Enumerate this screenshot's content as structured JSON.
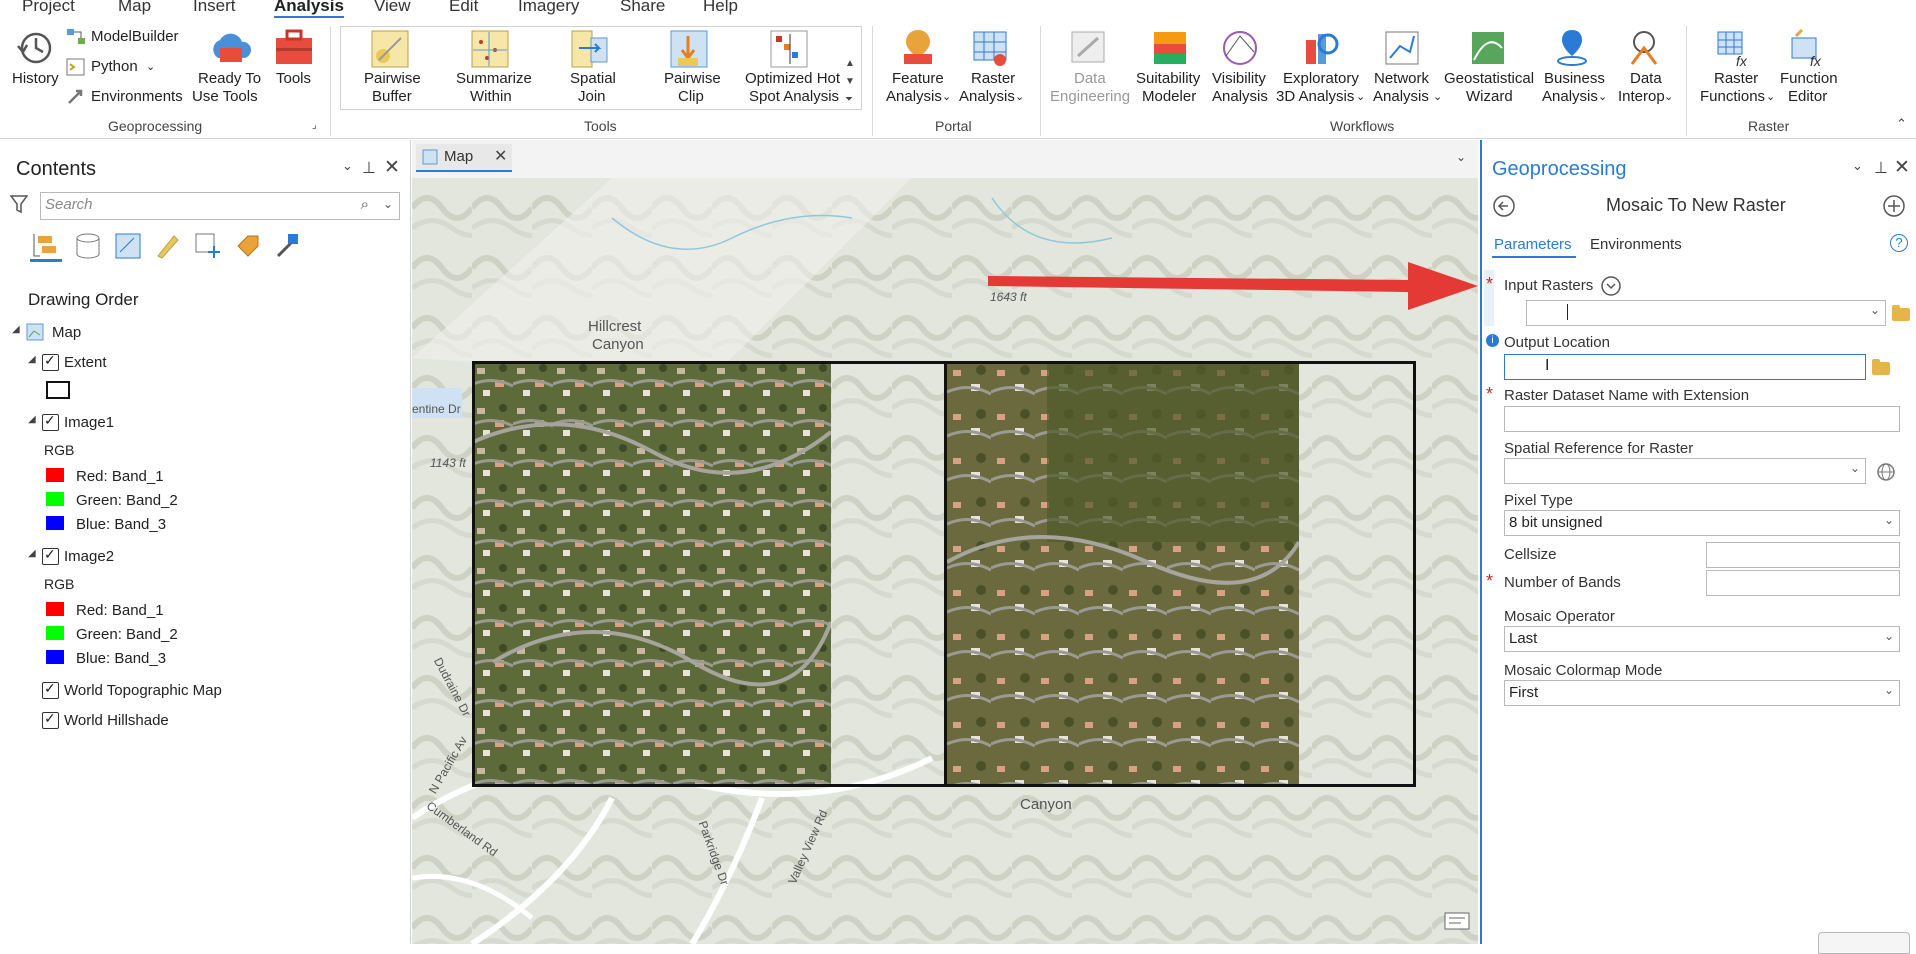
{
  "menu": {
    "tabs": [
      {
        "label": "Project",
        "active": false
      },
      {
        "label": "Map",
        "active": false
      },
      {
        "label": "Insert",
        "active": false
      },
      {
        "label": "Analysis",
        "active": true
      },
      {
        "label": "View",
        "active": false
      },
      {
        "label": "Edit",
        "active": false
      },
      {
        "label": "Imagery",
        "active": false
      },
      {
        "label": "Share",
        "active": false
      },
      {
        "label": "Help",
        "active": false
      }
    ]
  },
  "ribbon": {
    "geoprocessing": {
      "history": "History",
      "modelbuilder": "ModelBuilder",
      "python": "Python",
      "environments": "Environments",
      "ready_to_use_1": "Ready To",
      "ready_to_use_2": "Use Tools",
      "tools": "Tools",
      "group_label": "Geoprocessing"
    },
    "tools": {
      "items": [
        {
          "l1": "Pairwise",
          "l2": "Buffer"
        },
        {
          "l1": "Summarize",
          "l2": "Within"
        },
        {
          "l1": "Spatial",
          "l2": "Join"
        },
        {
          "l1": "Pairwise",
          "l2": "Clip"
        },
        {
          "l1": "Optimized Hot",
          "l2": "Spot Analysis"
        }
      ],
      "group_label": "Tools"
    },
    "portal": {
      "feature_1": "Feature",
      "feature_2": "Analysis",
      "raster_1": "Raster",
      "raster_2": "Analysis",
      "group_label": "Portal"
    },
    "workflows": {
      "items": [
        {
          "l1": "Data",
          "l2": "Engineering",
          "disabled": true
        },
        {
          "l1": "Suitability",
          "l2": "Modeler",
          "disabled": false
        },
        {
          "l1": "Visibility",
          "l2": "Analysis",
          "disabled": false
        },
        {
          "l1": "Exploratory",
          "l2": "3D Analysis",
          "disabled": false
        },
        {
          "l1": "Network",
          "l2": "Analysis",
          "disabled": false
        },
        {
          "l1": "Geostatistical",
          "l2": "Wizard",
          "disabled": false
        },
        {
          "l1": "Business",
          "l2": "Analysis",
          "disabled": false
        },
        {
          "l1": "Data",
          "l2": "Interop",
          "disabled": false
        }
      ],
      "group_label": "Workflows"
    },
    "raster": {
      "functions_1": "Raster",
      "functions_2": "Functions",
      "editor_1": "Function",
      "editor_2": "Editor",
      "group_label": "Raster"
    }
  },
  "contents": {
    "title": "Contents",
    "search_placeholder": "Search",
    "drawing_order": "Drawing Order",
    "map": "Map",
    "extent": "Extent",
    "image1": "Image1",
    "image2": "Image2",
    "rgb": "RGB",
    "bands": [
      {
        "label": "Red:   Band_1",
        "color": "#ff0000"
      },
      {
        "label": "Green: Band_2",
        "color": "#00ff00"
      },
      {
        "label": "Blue:  Band_3",
        "color": "#0000ff"
      }
    ],
    "topo": "World Topographic Map",
    "hillshade": "World Hillshade"
  },
  "map": {
    "tab_label": "Map",
    "labels": {
      "hillcrest": "Hillcrest",
      "canyon1": "Canyon",
      "canyon2": "Canyon",
      "elev1": "1643 ft",
      "elev2": "1143 ft",
      "valley": "Valley View Rd",
      "parkridge": "Parkridge Dr",
      "cumberland": "Cumberland Rd",
      "pacific": "N Pacific Av",
      "dudraine": "Dudraine Dr",
      "entine": "entine Dr"
    },
    "arrow_color": "#e53935"
  },
  "geoprocessing": {
    "title": "Geoprocessing",
    "tool_title": "Mosaic To New Raster",
    "tabs": {
      "parameters": "Parameters",
      "environments": "Environments"
    },
    "params": {
      "input_rasters": "Input Rasters",
      "output_location": "Output Location",
      "dataset_name": "Raster Dataset Name with Extension",
      "spatial_ref": "Spatial Reference for  Raster",
      "pixel_type": "Pixel Type",
      "pixel_type_value": "8 bit unsigned",
      "cellsize": "Cellsize",
      "num_bands": "Number of Bands",
      "mosaic_operator": "Mosaic Operator",
      "mosaic_operator_value": "Last",
      "colormap_mode": "Mosaic Colormap Mode",
      "colormap_mode_value": "First"
    }
  }
}
